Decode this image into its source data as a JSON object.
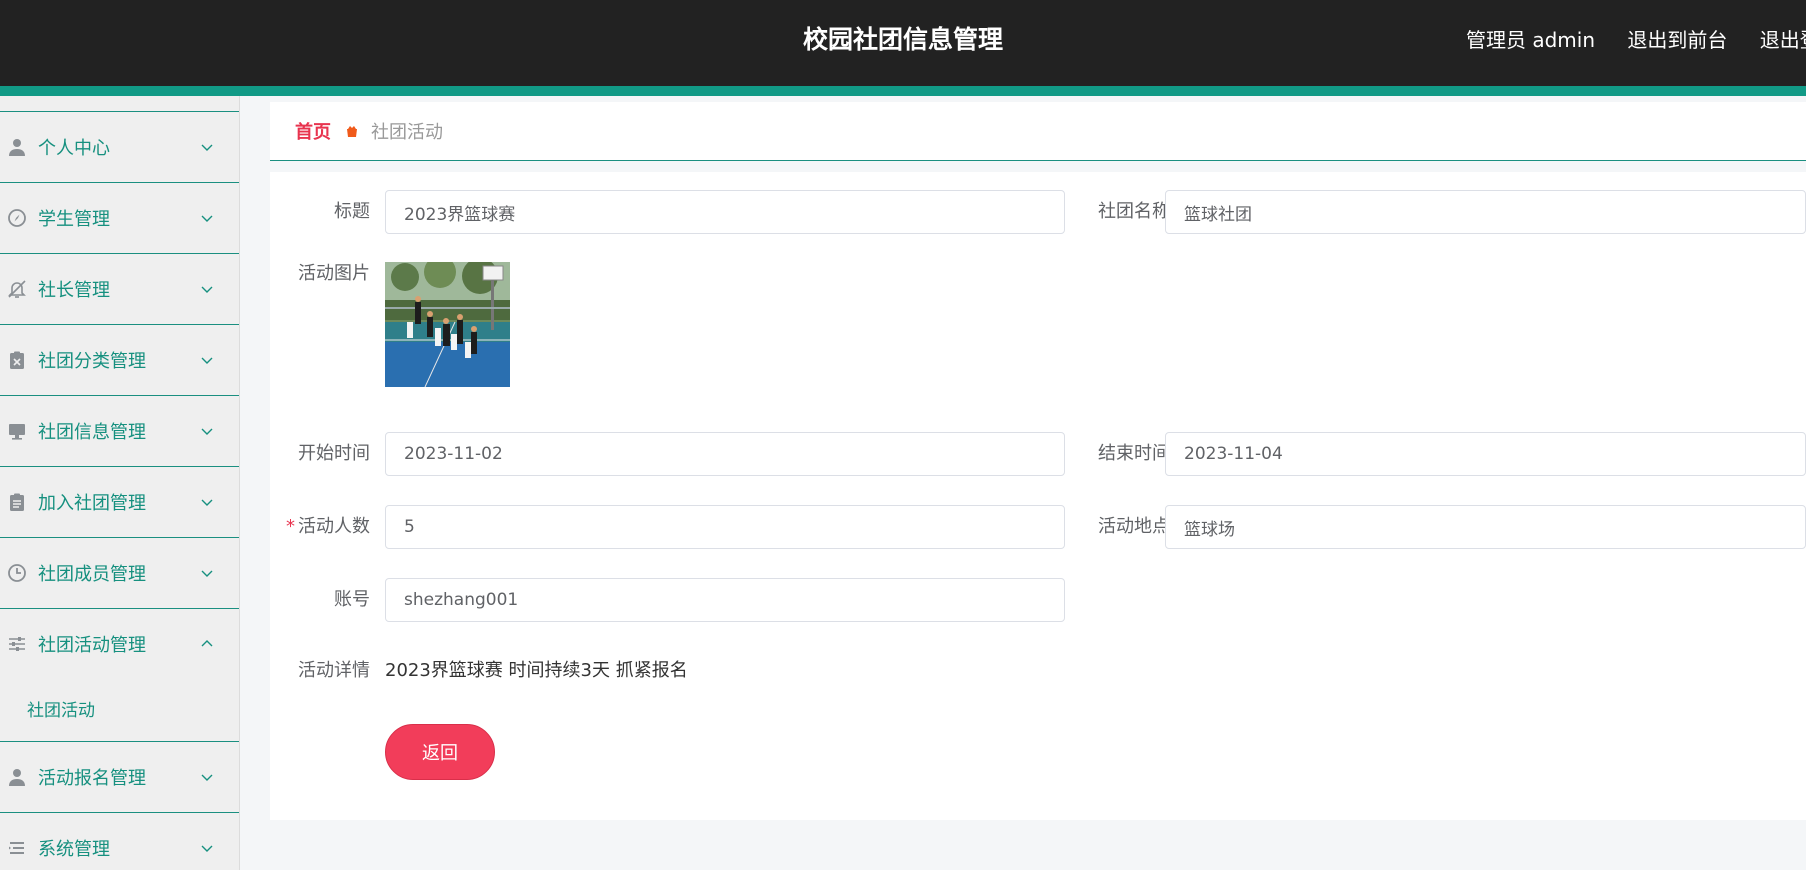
{
  "header": {
    "title": "校园社团信息管理",
    "actions": [
      "管理员 admin",
      "退出到前台",
      "退出登录"
    ]
  },
  "sidebar": {
    "items": [
      {
        "label": "个人中心",
        "icon": "user-icon",
        "expanded": false
      },
      {
        "label": "学生管理",
        "icon": "compass-icon",
        "expanded": false
      },
      {
        "label": "社长管理",
        "icon": "bell-off-icon",
        "expanded": false
      },
      {
        "label": "社团分类管理",
        "icon": "clipboard-x-icon",
        "expanded": false
      },
      {
        "label": "社团信息管理",
        "icon": "monitor-icon",
        "expanded": false
      },
      {
        "label": "加入社团管理",
        "icon": "clipboard-icon",
        "expanded": false
      },
      {
        "label": "社团成员管理",
        "icon": "clock-icon",
        "expanded": false
      },
      {
        "label": "社团活动管理",
        "icon": "sliders-icon",
        "expanded": true,
        "children": [
          "社团活动"
        ]
      },
      {
        "label": "活动报名管理",
        "icon": "user-icon",
        "expanded": false
      },
      {
        "label": "系统管理",
        "icon": "list-icon",
        "expanded": false
      }
    ]
  },
  "breadcrumb": {
    "home": "首页",
    "current": "社团活动"
  },
  "form": {
    "title_label": "标题",
    "title_value": "2023界篮球赛",
    "club_label": "社团名称",
    "club_value": "篮球社团",
    "photo_label": "活动图片",
    "start_label": "开始时间",
    "start_value": "2023-11-02",
    "end_label": "结束时间",
    "end_value": "2023-11-04",
    "count_label": "活动人数",
    "count_value": "5",
    "location_label": "活动地点",
    "location_value": "篮球场",
    "account_label": "账号",
    "account_value": "shezhang001",
    "detail_label": "活动详情",
    "detail_value": "2023界篮球赛 时间持续3天 抓紧报名",
    "back_label": "返回",
    "required_mark": "*"
  },
  "colors": {
    "header_bg": "#222222",
    "accent_teal": "#119a86",
    "menu_text": "#16907f",
    "primary_red": "#f23d5a"
  }
}
